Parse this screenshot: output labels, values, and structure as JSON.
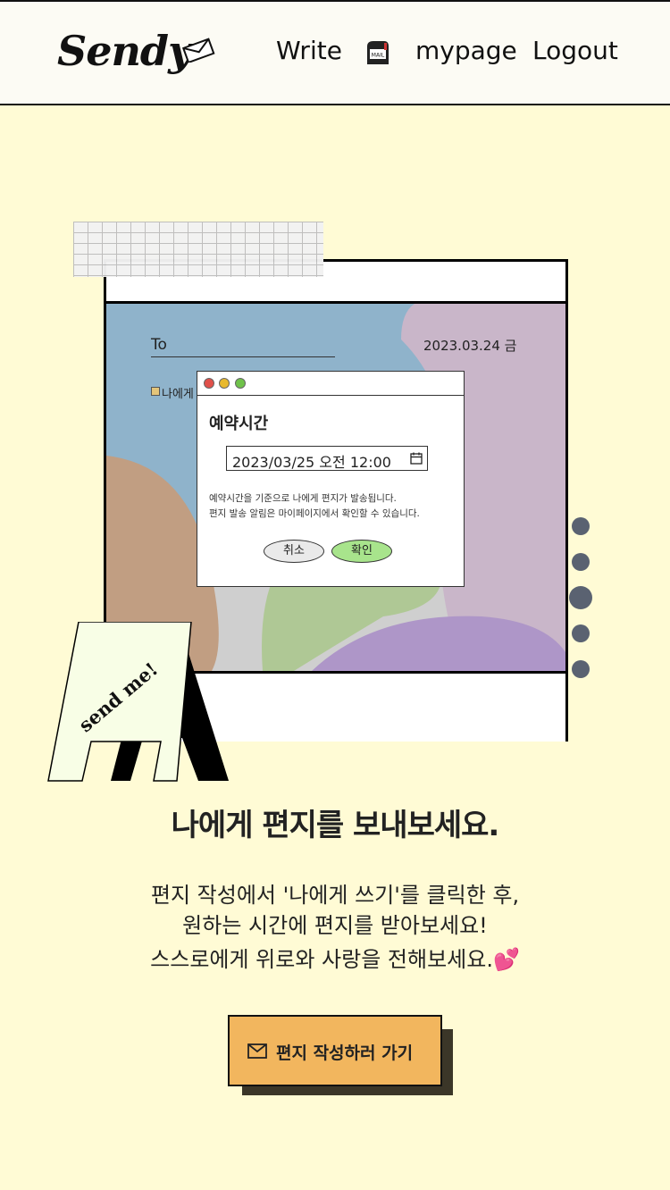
{
  "header": {
    "logo_text": "Sendy",
    "logo_icon": "envelope-icon",
    "nav": {
      "write": "Write",
      "mailbox_icon": "mailbox-icon",
      "mailbox_icon_text": "MAIL",
      "mypage": "mypage",
      "logout": "Logout"
    }
  },
  "illustration": {
    "letter": {
      "to_label": "To",
      "date": "2023.03.24 금",
      "self_label": "나에게"
    },
    "dialog": {
      "title": "예약시간",
      "datetime_value": "2023/03/25 오전 12:00",
      "note_line1": "예약시간을 기준으로 나에게 편지가 발송됩니다.",
      "note_line2": "편지 발송 알림은 마이페이지에서 확인할 수 있습니다.",
      "cancel_label": "취소",
      "confirm_label": "확인"
    },
    "sign_text": "send me!",
    "pager": {
      "count": 5,
      "active_index": 2
    }
  },
  "main": {
    "headline": "나에게 편지를 보내보세요.",
    "description": [
      "편지 작성에서 '나에게 쓰기'를 클릭한 후,",
      "원하는 시간에 편지를 받아보세요!",
      "스스로에게 위로와 사랑을 전해보세요.💕"
    ],
    "cta_label": "편지 작성하러 가기"
  },
  "colors": {
    "background": "#FFFBD5",
    "header_bg": "#FCFBF4",
    "cta_bg": "#F2B65E",
    "cta_shadow": "#3B3628",
    "confirm_green": "#A8E48C",
    "pager_dot": "#5A6271"
  }
}
